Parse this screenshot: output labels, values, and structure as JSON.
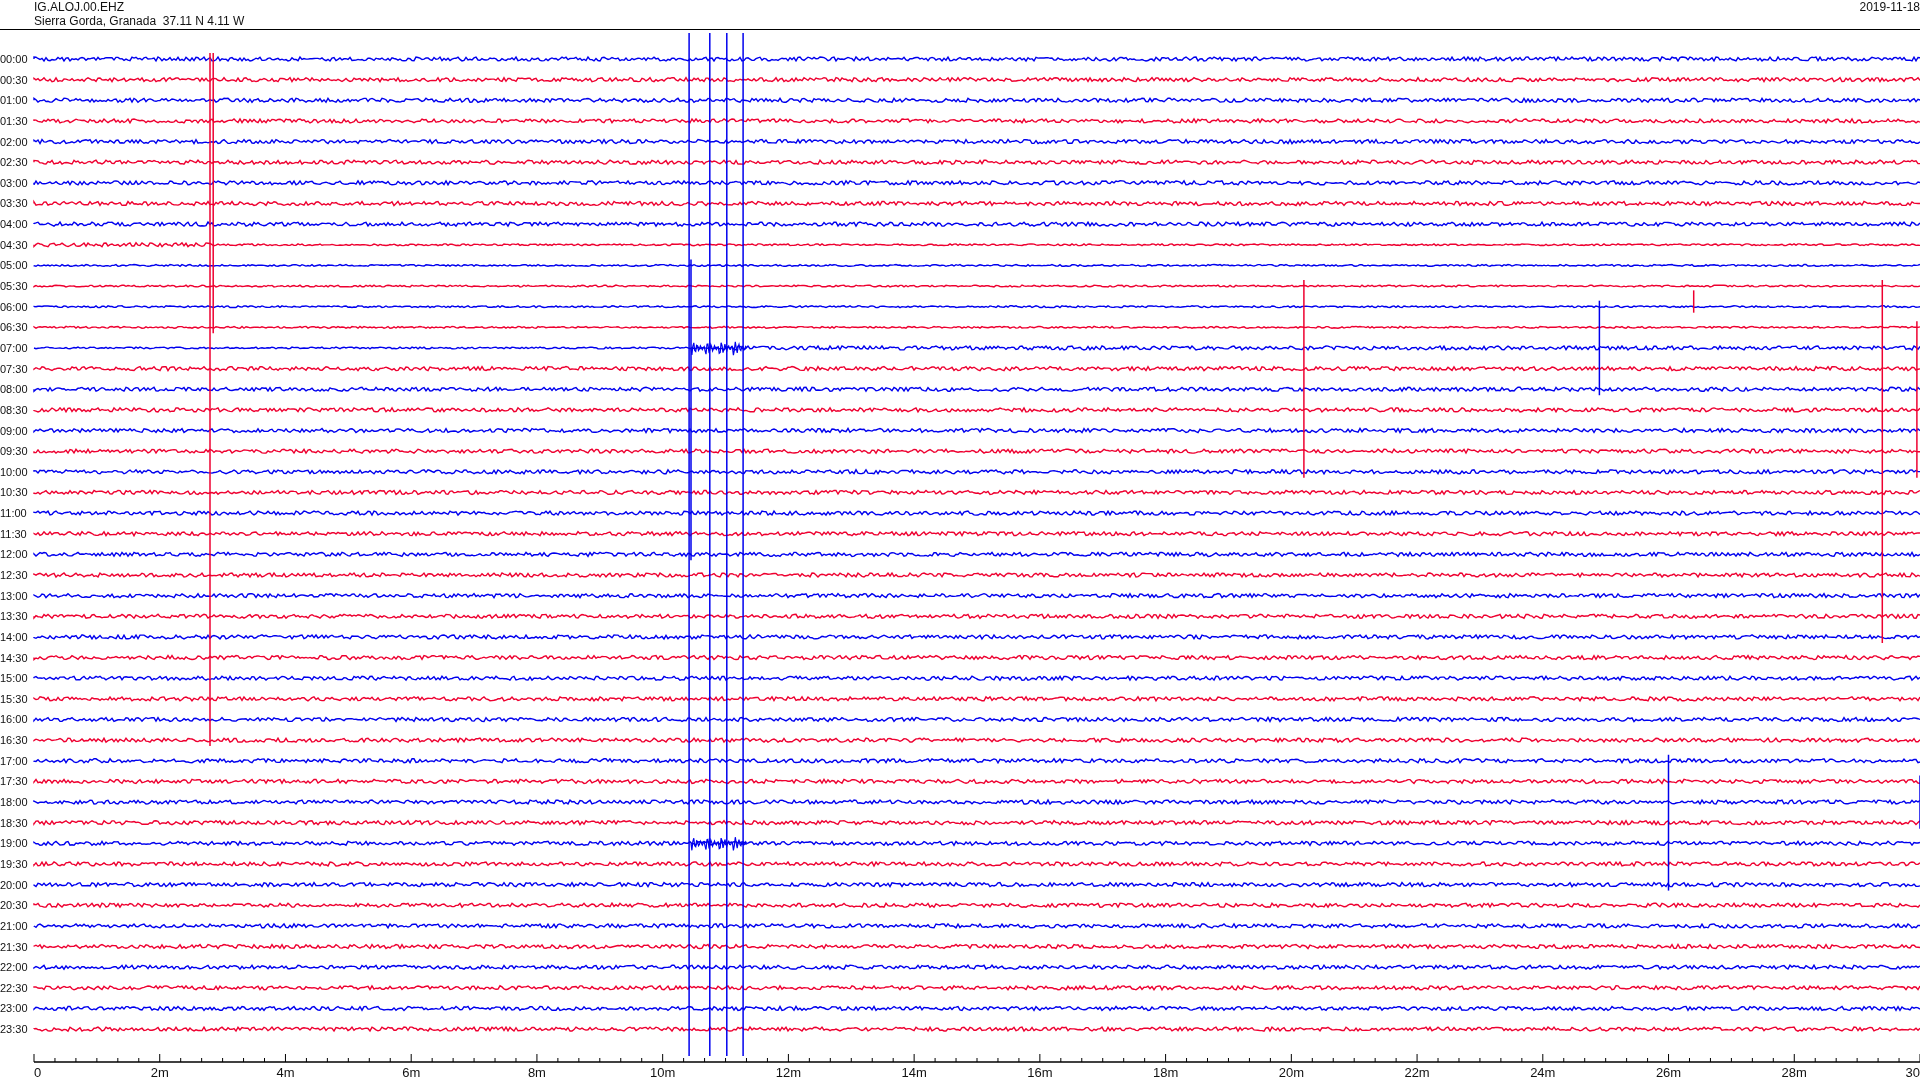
{
  "header": {
    "station": "IG.ALOJ.00.EHZ",
    "location": "Sierra Gorda, Granada  37.11 N 4.11 W",
    "date": "2019-11-18"
  },
  "rows": [
    {
      "time": "00:00",
      "color": "#0000ee"
    },
    {
      "time": "00:30",
      "color": "#ee0030"
    },
    {
      "time": "01:00",
      "color": "#0000ee"
    },
    {
      "time": "01:30",
      "color": "#ee0030"
    },
    {
      "time": "02:00",
      "color": "#0000ee"
    },
    {
      "time": "02:30",
      "color": "#ee0030"
    },
    {
      "time": "03:00",
      "color": "#0000ee"
    },
    {
      "time": "03:30",
      "color": "#ee0030"
    },
    {
      "time": "04:00",
      "color": "#0000ee"
    },
    {
      "time": "04:30",
      "color": "#ee0030"
    },
    {
      "time": "05:00",
      "color": "#0000ee"
    },
    {
      "time": "05:30",
      "color": "#ee0030"
    },
    {
      "time": "06:00",
      "color": "#0000ee"
    },
    {
      "time": "06:30",
      "color": "#ee0030"
    },
    {
      "time": "07:00",
      "color": "#0000ee"
    },
    {
      "time": "07:30",
      "color": "#ee0030"
    },
    {
      "time": "08:00",
      "color": "#0000ee"
    },
    {
      "time": "08:30",
      "color": "#ee0030"
    },
    {
      "time": "09:00",
      "color": "#0000ee"
    },
    {
      "time": "09:30",
      "color": "#ee0030"
    },
    {
      "time": "10:00",
      "color": "#0000ee"
    },
    {
      "time": "10:30",
      "color": "#ee0030"
    },
    {
      "time": "11:00",
      "color": "#0000ee"
    },
    {
      "time": "11:30",
      "color": "#ee0030"
    },
    {
      "time": "12:00",
      "color": "#0000ee"
    },
    {
      "time": "12:30",
      "color": "#ee0030"
    },
    {
      "time": "13:00",
      "color": "#0000ee"
    },
    {
      "time": "13:30",
      "color": "#ee0030"
    },
    {
      "time": "14:00",
      "color": "#0000ee"
    },
    {
      "time": "14:30",
      "color": "#ee0030"
    },
    {
      "time": "15:00",
      "color": "#0000ee"
    },
    {
      "time": "15:30",
      "color": "#ee0030"
    },
    {
      "time": "16:00",
      "color": "#0000ee"
    },
    {
      "time": "16:30",
      "color": "#ee0030"
    },
    {
      "time": "17:00",
      "color": "#0000ee"
    },
    {
      "time": "17:30",
      "color": "#ee0030"
    },
    {
      "time": "18:00",
      "color": "#0000ee"
    },
    {
      "time": "18:30",
      "color": "#ee0030"
    },
    {
      "time": "19:00",
      "color": "#0000ee"
    },
    {
      "time": "19:30",
      "color": "#ee0030"
    },
    {
      "time": "20:00",
      "color": "#0000ee"
    },
    {
      "time": "20:30",
      "color": "#ee0030"
    },
    {
      "time": "21:00",
      "color": "#0000ee"
    },
    {
      "time": "21:30",
      "color": "#ee0030"
    },
    {
      "time": "22:00",
      "color": "#0000ee"
    },
    {
      "time": "22:30",
      "color": "#ee0030"
    },
    {
      "time": "23:00",
      "color": "#0000ee"
    },
    {
      "time": "23:30",
      "color": "#ee0030"
    }
  ],
  "x_axis": {
    "labels": [
      "0",
      "2m",
      "4m",
      "6m",
      "8m",
      "10m",
      "12m",
      "14m",
      "16m",
      "18m",
      "20m",
      "22m",
      "24m",
      "26m",
      "28m",
      "30"
    ]
  }
}
